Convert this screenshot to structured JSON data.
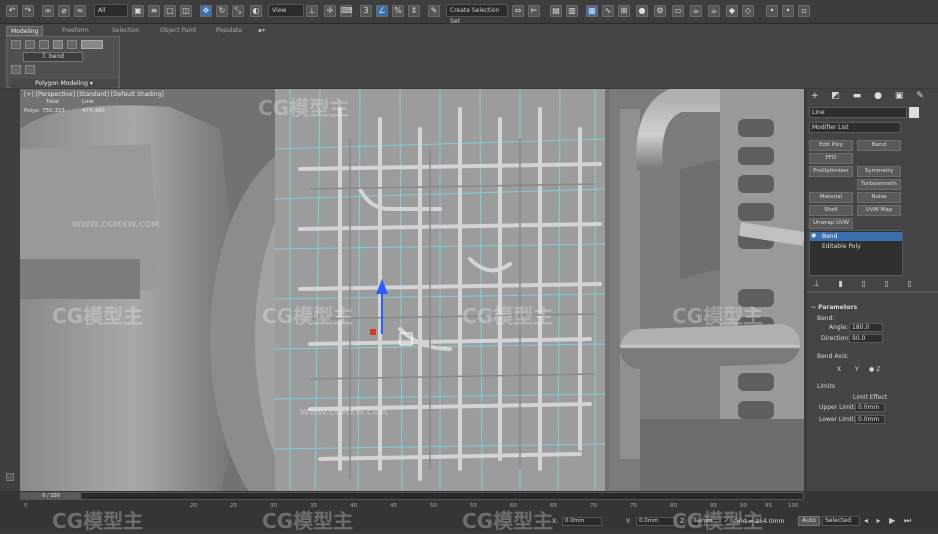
{
  "toolbar": {
    "all_filter": "All",
    "view_dropdown": "View",
    "selection_set": "Create Selection Set"
  },
  "ribbon": {
    "tabs": [
      "Modeling",
      "Freeform",
      "Selection",
      "Object Paint",
      "Populate"
    ],
    "subtitle": "Polygon Modeling",
    "edit_label": "T. bend"
  },
  "viewport": {
    "label": "[+] [Perspective] [Standard] [Default Shading]",
    "stats_total": "Total",
    "stats_line": "Line",
    "polys_label": "Polys:",
    "polys_value": "750,353",
    "line_value": "474,480"
  },
  "cmd": {
    "object_name": "Line",
    "modifier_list": "Modifier List",
    "buttons": [
      "Edit Poly",
      "Bend",
      "FFD",
      "ProOptimizer",
      "Symmetry",
      "Turbosmooth",
      "Material",
      "Noise",
      "Shell",
      "UVW Map",
      "Unwrap UVW"
    ],
    "stack": [
      "Bend",
      "Editable Poly"
    ],
    "parameters_title": "Parameters",
    "bend_label": "Bend:",
    "angle_label": "Angle:",
    "angle_value": "180.0",
    "direction_label": "Direction:",
    "direction_value": "90.0",
    "bend_axis_label": "Bend Axis:",
    "axes": [
      "X",
      "Y",
      "Z"
    ],
    "limits_label": "Limits",
    "limit_effect": "Limit Effect",
    "upper_label": "Upper Limit:",
    "upper_value": "0.0mm",
    "lower_label": "Lower Limit:",
    "lower_value": "0.0mm"
  },
  "timeline": {
    "frame": "0 / 100",
    "ticks": [
      "0",
      "20",
      "25",
      "30",
      "35",
      "40",
      "45",
      "50",
      "55",
      "60",
      "65",
      "70",
      "75",
      "80",
      "85",
      "90",
      "95",
      "100"
    ],
    "x_label": "X:",
    "y_label": "Y:",
    "z_label": "Z:",
    "x_value": "0.0mm",
    "y_value": "0.0mm",
    "z_value": "0.0mm",
    "grid": "Grid = 254.0mm",
    "auto": "Auto",
    "selected": "Selected"
  },
  "watermark": {
    "text": "CG模型主",
    "url": "WWW.CGMXW.COM"
  },
  "colors": {
    "accent_blue": "#3a6fb0",
    "wire_cyan": "#7fd6e0",
    "toolbar_bg": "#3d3d3d"
  }
}
